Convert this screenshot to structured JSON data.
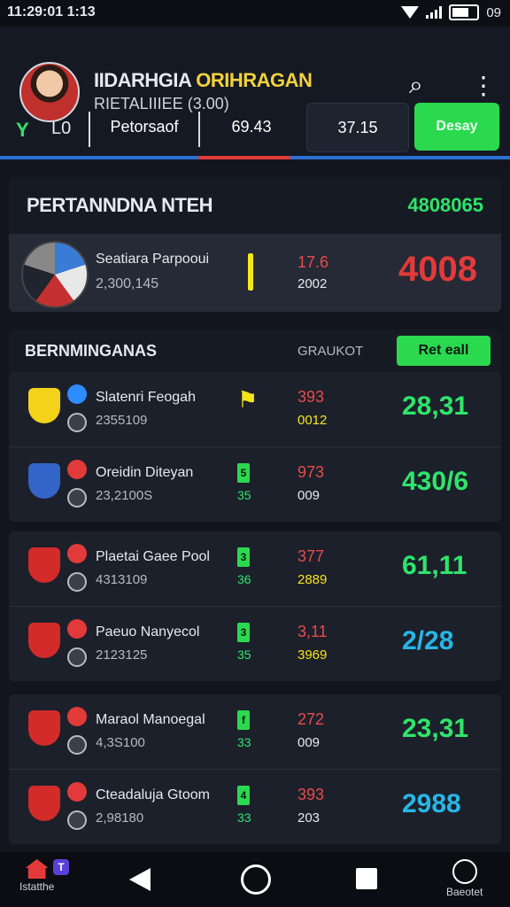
{
  "status": {
    "time": "11:29:01 1:13",
    "battery": "09"
  },
  "header": {
    "title_a": "IIDARHGIA",
    "title_b": "ORIHRAGAN",
    "subtitle": "RIETALIIIEE (3.00)",
    "icons": [
      "search-icon",
      "more-vertical-icon"
    ]
  },
  "filters": {
    "brand": "L0",
    "label": "Petorsaof",
    "val1": "69.43",
    "val2": "37.15",
    "cta": "Desay"
  },
  "featured": {
    "title": "PERTANNDNA NTEH",
    "count": "4808065",
    "name": "Seatiara Parpooui",
    "number": "2,300,145",
    "odd1": "17.6",
    "odd2": "2002",
    "big": "4008"
  },
  "section": {
    "title": "BERNMINGANAS",
    "col": "GRAUKOT",
    "button": "Ret eall"
  },
  "matches": [
    {
      "name": "Slatenri Feogah",
      "number": "2355109",
      "badge": "",
      "sub": "",
      "flag": true,
      "odd1": "393",
      "odd2": "0012",
      "big": "28,31",
      "crest": "#f5d21a",
      "mini": "#2d8cff",
      "odd2color": "#f5e419",
      "bigcolor": "#2ee56a"
    },
    {
      "name": "Oreidin Diteyan",
      "number": "23,2100S",
      "badge": "5",
      "sub": "35",
      "flag": false,
      "odd1": "973",
      "odd2": "009",
      "big": "430/6",
      "crest": "#3364c8",
      "mini": "#e23a3a",
      "odd2color": "#e6e9ef",
      "bigcolor": "#2ee56a"
    },
    {
      "name": "Plaetai Gaee Pool",
      "number": "4313109",
      "badge": "3",
      "sub": "36",
      "flag": false,
      "odd1": "377",
      "odd2": "2889",
      "big": "61,11",
      "crest": "#d32a2a",
      "mini": "#e23a3a",
      "odd2color": "#f5e419",
      "bigcolor": "#2ee56a"
    },
    {
      "name": "Paeuo Nanyecol",
      "number": "2123125",
      "badge": "3",
      "sub": "35",
      "flag": false,
      "odd1": "3,11",
      "odd2": "3969",
      "big": "2/28",
      "crest": "#d32a2a",
      "mini": "#e23a3a",
      "odd2color": "#f5e419",
      "bigcolor": "#27b7e6"
    },
    {
      "name": "Maraol Manoegal",
      "number": "4,3S100",
      "badge": "f",
      "sub": "33",
      "flag": false,
      "odd1": "272",
      "odd2": "009",
      "big": "23,31",
      "crest": "#d32a2a",
      "mini": "#e23a3a",
      "odd2color": "#e6e9ef",
      "bigcolor": "#2ee56a"
    },
    {
      "name": "Cteadaluja Gtoom",
      "number": "2,98180",
      "badge": "4",
      "sub": "33",
      "flag": false,
      "odd1": "393",
      "odd2": "203",
      "big": "2988",
      "crest": "#d32a2a",
      "mini": "#e23a3a",
      "odd2color": "#e6e9ef",
      "bigcolor": "#27b7e6"
    }
  ],
  "nav": {
    "home_label": "Istatthe",
    "home_badge": "T",
    "right_label": "Baeotet"
  }
}
